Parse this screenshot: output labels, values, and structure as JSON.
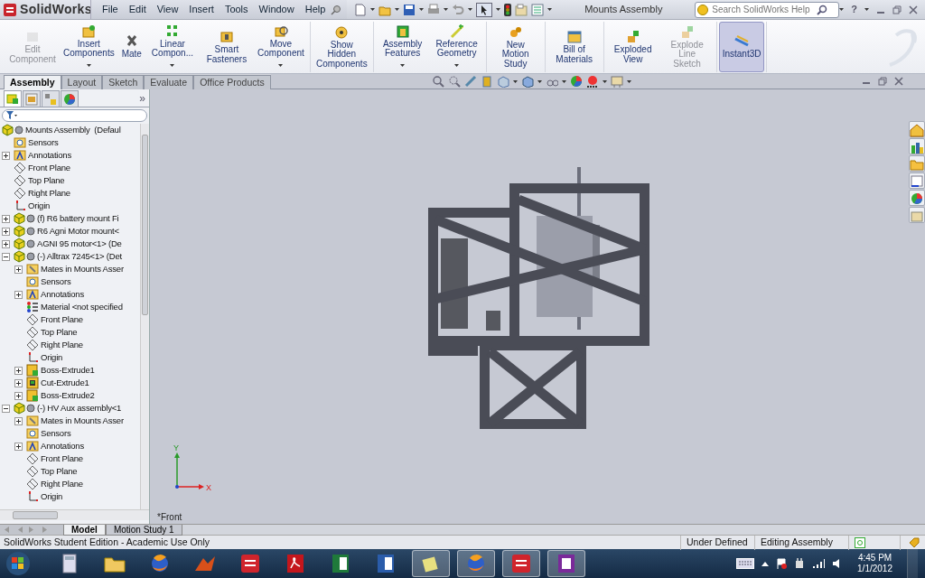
{
  "app": {
    "name": "SolidWorks",
    "menu": [
      "File",
      "Edit",
      "View",
      "Insert",
      "Tools",
      "Window",
      "Help"
    ],
    "title": "Mounts Assembly",
    "search": {
      "placeholder": "Search SolidWorks Help"
    },
    "help_label": "?"
  },
  "ribbon": {
    "groups": [
      [
        {
          "label": "Edit Component",
          "kind": "edit",
          "disabled": true,
          "dropdown": false,
          "selected": false
        },
        {
          "label": "Insert Components",
          "kind": "insert",
          "disabled": false,
          "dropdown": true,
          "selected": false
        },
        {
          "label": "Mate",
          "kind": "mate",
          "disabled": false,
          "dropdown": false,
          "selected": false
        },
        {
          "label": "Linear Compon...",
          "kind": "pattern",
          "disabled": false,
          "dropdown": true,
          "selected": false
        },
        {
          "label": "Smart Fasteners",
          "kind": "fastener",
          "disabled": false,
          "dropdown": false,
          "selected": false
        },
        {
          "label": "Move Component",
          "kind": "move",
          "disabled": false,
          "dropdown": true,
          "selected": false
        }
      ],
      [
        {
          "label": "Show Hidden Components",
          "kind": "show",
          "disabled": false,
          "dropdown": false,
          "selected": false
        }
      ],
      [
        {
          "label": "Assembly Features",
          "kind": "features",
          "disabled": false,
          "dropdown": true,
          "selected": false
        },
        {
          "label": "Reference Geometry",
          "kind": "geometry",
          "disabled": false,
          "dropdown": true,
          "selected": false
        }
      ],
      [
        {
          "label": "New Motion Study",
          "kind": "motion",
          "disabled": false,
          "dropdown": false,
          "selected": false
        }
      ],
      [
        {
          "label": "Bill of Materials",
          "kind": "bom",
          "disabled": false,
          "dropdown": false,
          "selected": false
        }
      ],
      [
        {
          "label": "Exploded View",
          "kind": "explode",
          "disabled": false,
          "dropdown": false,
          "selected": false
        },
        {
          "label": "Explode Line Sketch",
          "kind": "explode",
          "disabled": true,
          "dropdown": false,
          "selected": false
        }
      ],
      [
        {
          "label": "Instant3D",
          "kind": "instant",
          "disabled": false,
          "dropdown": false,
          "selected": true
        }
      ]
    ]
  },
  "command_tabs": [
    {
      "label": "Assembly",
      "selected": true
    },
    {
      "label": "Layout",
      "selected": false
    },
    {
      "label": "Sketch",
      "selected": false
    },
    {
      "label": "Evaluate",
      "selected": false
    },
    {
      "label": "Office Products",
      "selected": false
    }
  ],
  "panel": {
    "more_label": "»",
    "tabs": [
      {
        "kind": "tree",
        "selected": true
      },
      {
        "kind": "property",
        "selected": false
      },
      {
        "kind": "config",
        "selected": false
      },
      {
        "kind": "display",
        "selected": false
      }
    ]
  },
  "tree": {
    "label": "Mounts Assembly  (Defaul",
    "kind": "assembly",
    "children": [
      {
        "label": "Sensors",
        "kind": "sensors"
      },
      {
        "label": "Annotations",
        "kind": "annotations",
        "expanded": false
      },
      {
        "label": "Front Plane",
        "kind": "plane"
      },
      {
        "label": "Top Plane",
        "kind": "plane"
      },
      {
        "label": "Right Plane",
        "kind": "plane"
      },
      {
        "label": "Origin",
        "kind": "origin"
      },
      {
        "label": "(f) R6 battery mount Fi",
        "kind": "assembly",
        "expanded": false
      },
      {
        "label": "R6 Agni Motor mount<",
        "kind": "assembly",
        "expanded": false
      },
      {
        "label": "AGNI 95 motor<1> (De",
        "kind": "assembly",
        "expanded": false
      },
      {
        "label": "(-) Alltrax 7245<1> (Det",
        "kind": "assembly",
        "expanded": true,
        "children": [
          {
            "label": "Mates in Mounts Asser",
            "kind": "mates",
            "expanded": false
          },
          {
            "label": "Sensors",
            "kind": "sensors"
          },
          {
            "label": "Annotations",
            "kind": "annotations",
            "expanded": false
          },
          {
            "label": "Material <not specified",
            "kind": "material"
          },
          {
            "label": "Front Plane",
            "kind": "plane"
          },
          {
            "label": "Top Plane",
            "kind": "plane"
          },
          {
            "label": "Right Plane",
            "kind": "plane"
          },
          {
            "label": "Origin",
            "kind": "origin"
          },
          {
            "label": "Boss-Extrude1",
            "kind": "boss",
            "expanded": false
          },
          {
            "label": "Cut-Extrude1",
            "kind": "cut",
            "expanded": false
          },
          {
            "label": "Boss-Extrude2",
            "kind": "boss",
            "expanded": false
          }
        ]
      },
      {
        "label": "(-) HV Aux assembly<1",
        "kind": "assembly",
        "expanded": true,
        "children": [
          {
            "label": "Mates in Mounts Asser",
            "kind": "mates",
            "expanded": false
          },
          {
            "label": "Sensors",
            "kind": "sensors"
          },
          {
            "label": "Annotations",
            "kind": "annotations",
            "expanded": false
          },
          {
            "label": "Front Plane",
            "kind": "plane"
          },
          {
            "label": "Top Plane",
            "kind": "plane"
          },
          {
            "label": "Right Plane",
            "kind": "plane"
          },
          {
            "label": "Origin",
            "kind": "origin"
          }
        ]
      }
    ]
  },
  "viewport": {
    "view_name": "*Front",
    "triad": {
      "y_label": "Y",
      "x_label": "X"
    }
  },
  "bottom_tabs": [
    {
      "label": "Model",
      "selected": true
    },
    {
      "label": "Motion Study 1",
      "selected": false
    }
  ],
  "status_bar": {
    "message": "SolidWorks Student Edition - Academic Use Only",
    "state": "Under Defined",
    "mode": "Editing Assembly"
  },
  "taskbar": {
    "apps": [
      {
        "kind": "calculator",
        "active": false
      },
      {
        "kind": "folder",
        "active": false
      },
      {
        "kind": "globe",
        "active": false
      },
      {
        "kind": "peak",
        "active": false
      },
      {
        "kind": "cad",
        "active": false
      },
      {
        "kind": "pdf",
        "active": false
      },
      {
        "kind": "sheet",
        "active": false
      },
      {
        "kind": "doc",
        "active": false
      },
      {
        "kind": "notes",
        "active": true
      },
      {
        "kind": "globe",
        "active": true
      },
      {
        "kind": "cad",
        "active": true
      },
      {
        "kind": "notebook",
        "active": true
      }
    ],
    "time": "4:45 PM",
    "date": "1/1/2012"
  }
}
